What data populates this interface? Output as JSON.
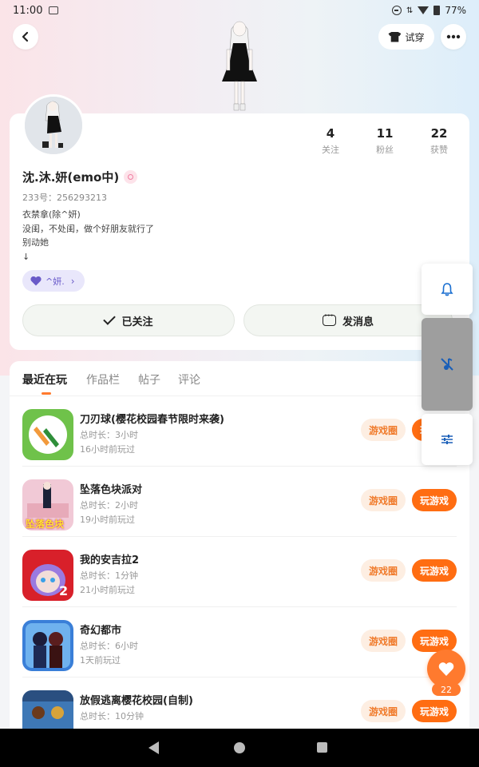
{
  "status_bar": {
    "time": "11:00",
    "battery": "77%"
  },
  "header": {
    "tryon_label": "试穿"
  },
  "profile": {
    "stats": [
      {
        "value": "4",
        "label": "关注"
      },
      {
        "value": "11",
        "label": "粉丝"
      },
      {
        "value": "22",
        "label": "获赞"
      }
    ],
    "username": "沈.沐.妍(emo中)",
    "uid": "233号：256293213",
    "bio": [
      "衣禁拿(除^妍)",
      "没闺，不处闺，做个好朋友就行了",
      "别动她",
      "↓"
    ],
    "tag": "^妍.",
    "follow_label": "已关注",
    "message_label": "发消息"
  },
  "tabs": [
    "最近在玩",
    "作品栏",
    "帖子",
    "评论"
  ],
  "game_buttons": {
    "circle": "游戏圈",
    "play": "玩游戏"
  },
  "games": [
    {
      "name": "刀刃球(樱花校园春节限时来袭)",
      "duration": "总时长：3小时",
      "last_played": "16小时前玩过"
    },
    {
      "name": "坠落色块派对",
      "duration": "总时长：2小时",
      "last_played": "19小时前玩过",
      "icon_text": "坠落色块"
    },
    {
      "name": "我的安吉拉2",
      "duration": "总时长：1分钟",
      "last_played": "21小时前玩过",
      "icon_text": "2"
    },
    {
      "name": "奇幻都市",
      "duration": "总时长：6小时",
      "last_played": "1天前玩过"
    },
    {
      "name": "放假逃离樱花校园(自制)",
      "duration": "总时长：10分钟",
      "last_played": ""
    }
  ],
  "fab": {
    "count": "22"
  },
  "colors": {
    "accent": "#ff6d12",
    "accent_light": "#fdeee2",
    "tag_bg": "#e9e7fb",
    "tag_text": "#6657c9"
  }
}
